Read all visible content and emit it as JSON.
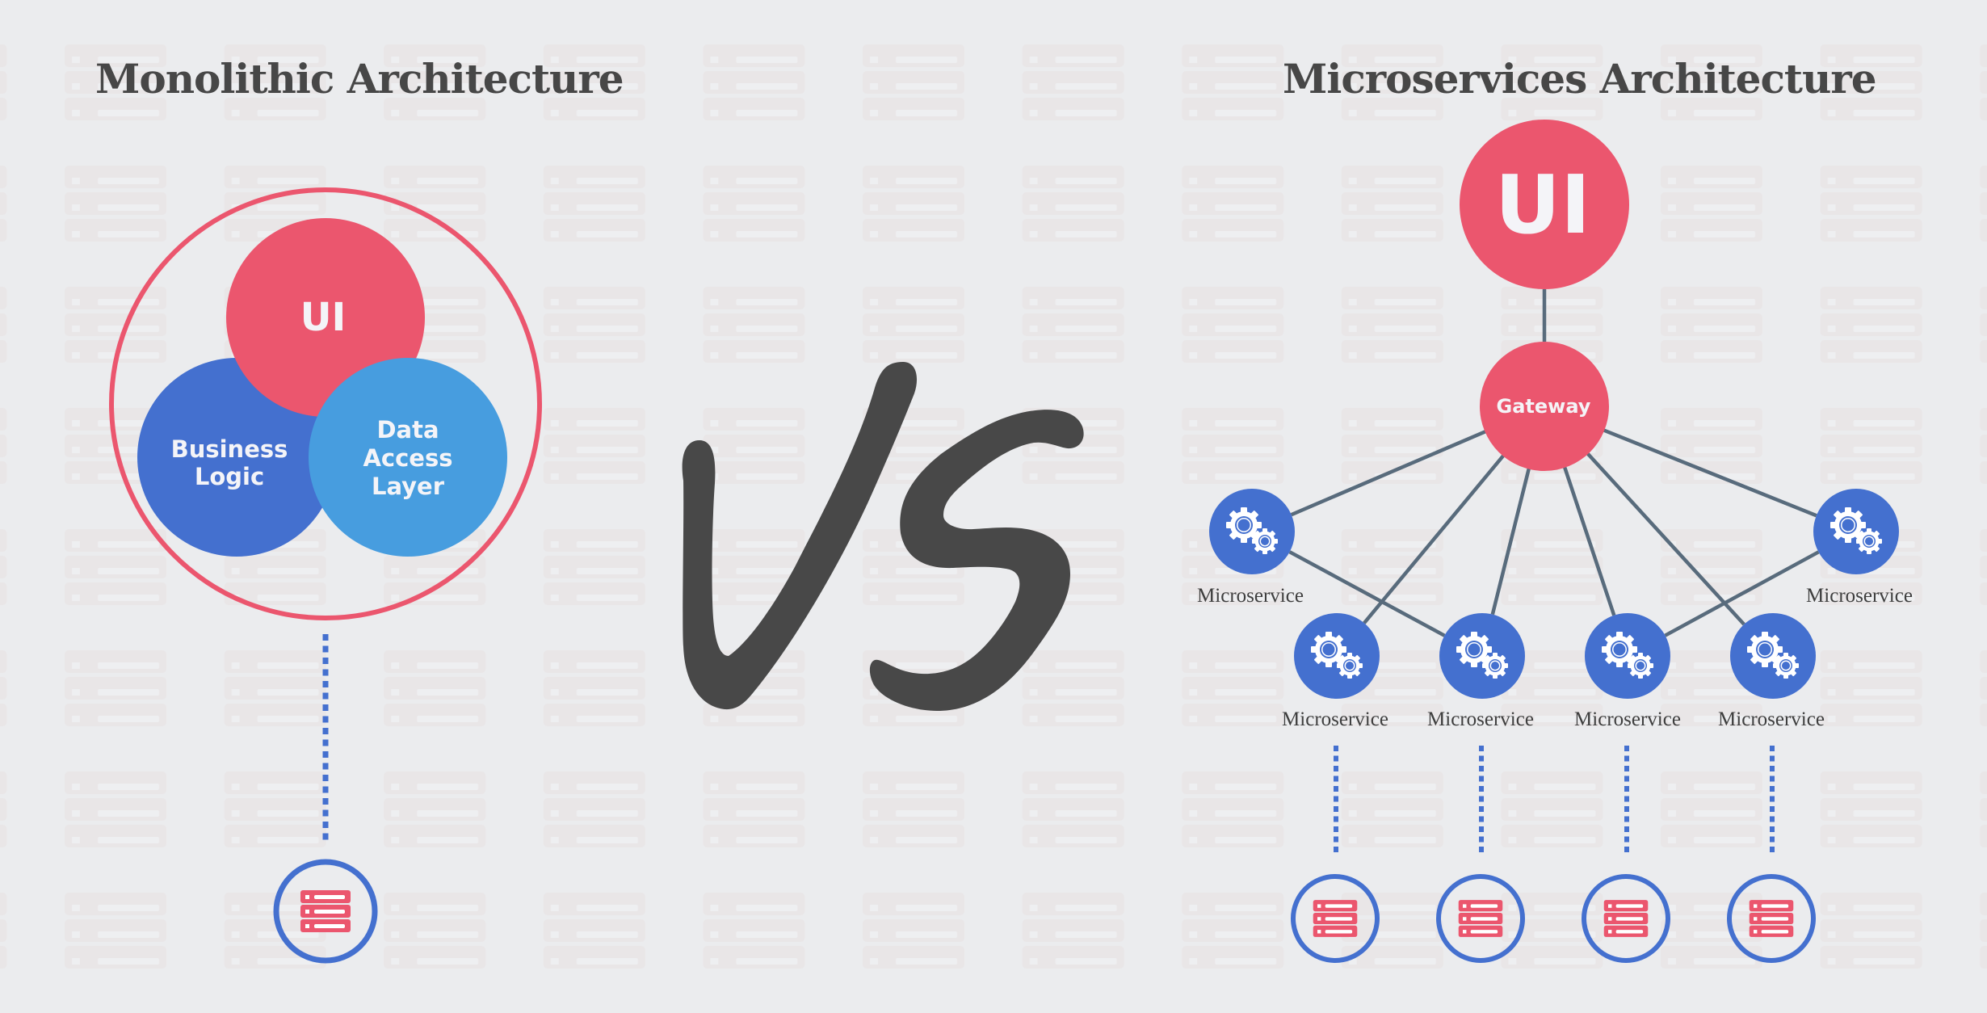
{
  "colors": {
    "background": "#ebecee",
    "pattern_block": "#e8e4e5",
    "pattern_slot": "#efeff1",
    "ui_red": "#eb566e",
    "business_blue": "#4470cf",
    "dal_blue": "#479ddf",
    "ring_red": "#eb566e",
    "microservice_blue": "#4470cf",
    "connector_gray": "#586b7c",
    "db_ring_blue": "#4470cf",
    "db_icon_red": "#eb566e",
    "vs_dark": "#484848",
    "title_text": "#474747"
  },
  "monolithic": {
    "title": "Monolithic Architecture",
    "ui_label": "UI",
    "business_logic_label": [
      "Business",
      "Logic"
    ],
    "data_access_label": [
      "Data",
      "Access",
      "Layer"
    ],
    "database_icon": "server-stack-icon"
  },
  "versus": {
    "label": "VS"
  },
  "microservices": {
    "title": "Microservices Architecture",
    "ui_label": "UI",
    "gateway_label": "Gateway",
    "services": [
      {
        "label": "Microservice",
        "icon": "gears-icon",
        "has_database": false
      },
      {
        "label": "Microservice",
        "icon": "gears-icon",
        "has_database": true
      },
      {
        "label": "Microservice",
        "icon": "gears-icon",
        "has_database": true
      },
      {
        "label": "Microservice",
        "icon": "gears-icon",
        "has_database": true
      },
      {
        "label": "Microservice",
        "icon": "gears-icon",
        "has_database": true
      },
      {
        "label": "Microservice",
        "icon": "gears-icon",
        "has_database": false
      }
    ],
    "connections": [
      [
        "gateway",
        0
      ],
      [
        "gateway",
        1
      ],
      [
        "gateway",
        2
      ],
      [
        "gateway",
        3
      ],
      [
        "gateway",
        4
      ],
      [
        "gateway",
        5
      ],
      [
        0,
        2
      ],
      [
        5,
        3
      ]
    ],
    "database_icon": "server-stack-icon"
  }
}
